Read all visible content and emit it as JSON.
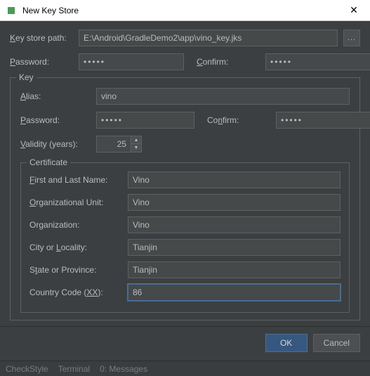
{
  "window": {
    "title": "New Key Store"
  },
  "keystore": {
    "path_label_pre": "K",
    "path_label_post": "ey store path:",
    "path_value": "E:\\Android\\GradleDemo2\\app\\vino_key.jks",
    "browse_label": "...",
    "password_label_pre": "P",
    "password_label_post": "assword:",
    "password_value": "•••••",
    "confirm_label_pre": "C",
    "confirm_label_post": "onfirm:",
    "confirm_value": "•••••"
  },
  "key_section": {
    "legend": "Key",
    "alias_label_pre": "A",
    "alias_label_post": "lias:",
    "alias_value": "vino",
    "password_label_pre": "P",
    "password_label_post": "assword:",
    "password_value": "•••••",
    "confirm_label_pre": "Co",
    "confirm_label_u": "n",
    "confirm_label_post": "firm:",
    "confirm_value": "•••••",
    "validity_label_pre": "V",
    "validity_label_post": "alidity (years):",
    "validity_value": "25"
  },
  "certificate": {
    "legend": "Certificate",
    "first_last_label_pre": "F",
    "first_last_label_post": "irst and Last Name:",
    "first_last_value": "Vino",
    "org_unit_label_pre": "O",
    "org_unit_label_post": "rganizational Unit:",
    "org_unit_value": "Vino",
    "org_label_pre": "Or",
    "org_label_u": "g",
    "org_label_post": "anization:",
    "org_value": "Vino",
    "city_label_pre": "City or ",
    "city_label_u": "L",
    "city_label_post": "ocality:",
    "city_value": "Tianjin",
    "state_label_pre": "S",
    "state_label_u": "t",
    "state_label_post": "ate or Province:",
    "state_value": "Tianjin",
    "country_label_pre": "Country Code (",
    "country_label_u": "XX",
    "country_label_post": "):",
    "country_value": "86"
  },
  "buttons": {
    "ok": "OK",
    "cancel": "Cancel"
  },
  "statusbar": {
    "item1": "CheckStyle",
    "item2": "Terminal",
    "item3": "0: Messages"
  }
}
